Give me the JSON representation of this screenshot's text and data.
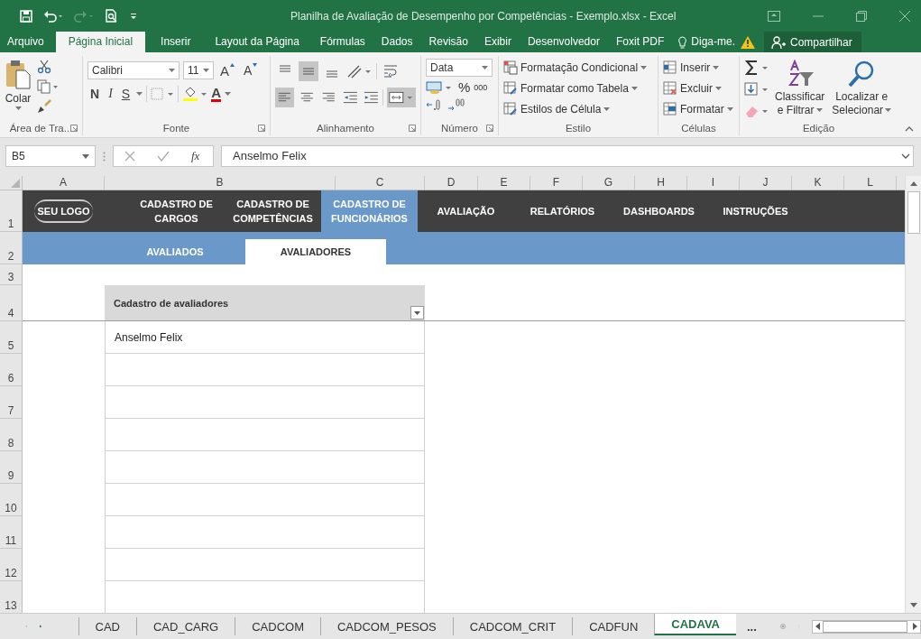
{
  "title_bar": {
    "title": "Planilha de Avaliação de Desempenho por Competências - Exemplo.xlsx - Excel"
  },
  "menu_tabs": [
    {
      "label": "Arquivo",
      "selected": false
    },
    {
      "label": "Página Inicial",
      "selected": true
    },
    {
      "label": "Inserir",
      "selected": false
    },
    {
      "label": "Layout da Página",
      "selected": false
    },
    {
      "label": "Fórmulas",
      "selected": false
    },
    {
      "label": "Dados",
      "selected": false
    },
    {
      "label": "Revisão",
      "selected": false
    },
    {
      "label": "Exibir",
      "selected": false
    },
    {
      "label": "Desenvolvedor",
      "selected": false
    },
    {
      "label": "Foxit PDF",
      "selected": false
    }
  ],
  "tell_me": "Diga-me.",
  "share": "Compartilhar",
  "ribbon": {
    "clipboard": {
      "paste": "Colar",
      "label": "Área de Tra..."
    },
    "font": {
      "name": "Calibri",
      "size": "11",
      "grow": "A",
      "shrink": "A",
      "styles": [
        "N",
        "I",
        "S"
      ],
      "font_color": "A",
      "label": "Fonte"
    },
    "alignment": {
      "vertical": [
        {
          "selected": false
        },
        {
          "selected": true
        },
        {
          "selected": false
        }
      ],
      "horizontal": [
        {
          "selected": true
        },
        {
          "selected": false
        },
        {
          "selected": false
        }
      ],
      "wrap_selected": false,
      "merge_selected": true,
      "label": "Alinhamento"
    },
    "number": {
      "format": "Data",
      "percent": "%",
      "thousands": "000",
      "label": "Número"
    },
    "styles": {
      "items": [
        "Formatação Condicional",
        "Formatar como Tabela",
        "Estilos de Célula"
      ],
      "label": "Estilo"
    },
    "cells": {
      "items": [
        "Inserir",
        "Excluir",
        "Formatar"
      ],
      "label": "Células"
    },
    "editing": {
      "sort": [
        "Classificar",
        "e Filtrar"
      ],
      "find": [
        "Localizar e",
        "Selecionar"
      ],
      "label": "Edição"
    }
  },
  "formula_bar": {
    "name_box": "B5",
    "function_label": "fx",
    "value": "Anselmo Felix"
  },
  "columns": [
    "A",
    "B",
    "C",
    "D",
    "E",
    "F",
    "G",
    "H",
    "I",
    "J",
    "K",
    "L"
  ],
  "rows": [
    "1",
    "2",
    "3",
    "4",
    "5",
    "6",
    "7",
    "8",
    "9",
    "10",
    "11",
    "12",
    "13"
  ],
  "sheet": {
    "logo": "SEU LOGO",
    "nav": [
      {
        "label": "CADASTRO DE\nCARGOS",
        "selected": false
      },
      {
        "label": "CADASTRO DE\nCOMPETÊNCIAS",
        "selected": false
      },
      {
        "label": "CADASTRO DE\nFUNCIONÁRIOS",
        "selected": true
      },
      {
        "label": "AVALIAÇÃO",
        "selected": false
      },
      {
        "label": "RELATÓRIOS",
        "selected": false
      },
      {
        "label": "DASHBOARDS",
        "selected": false
      },
      {
        "label": "INSTRUÇÕES",
        "selected": false
      }
    ],
    "subnav": [
      {
        "label": "AVALIADOS",
        "selected": false
      },
      {
        "label": "AVALIADORES",
        "selected": true
      }
    ],
    "table": {
      "header": "Cadastro de avaliadores",
      "entries": [
        "Anselmo Felix"
      ]
    }
  },
  "sheet_tabs": [
    {
      "label": "CAD",
      "selected": false
    },
    {
      "label": "CAD_CARG",
      "selected": false
    },
    {
      "label": "CADCOM",
      "selected": false
    },
    {
      "label": "CADCOM_PESOS",
      "selected": false
    },
    {
      "label": "CADCOM_CRIT",
      "selected": false
    },
    {
      "label": "CADFUN",
      "selected": false
    },
    {
      "label": "CADAVA",
      "selected": true
    }
  ],
  "more_tabs": "..."
}
